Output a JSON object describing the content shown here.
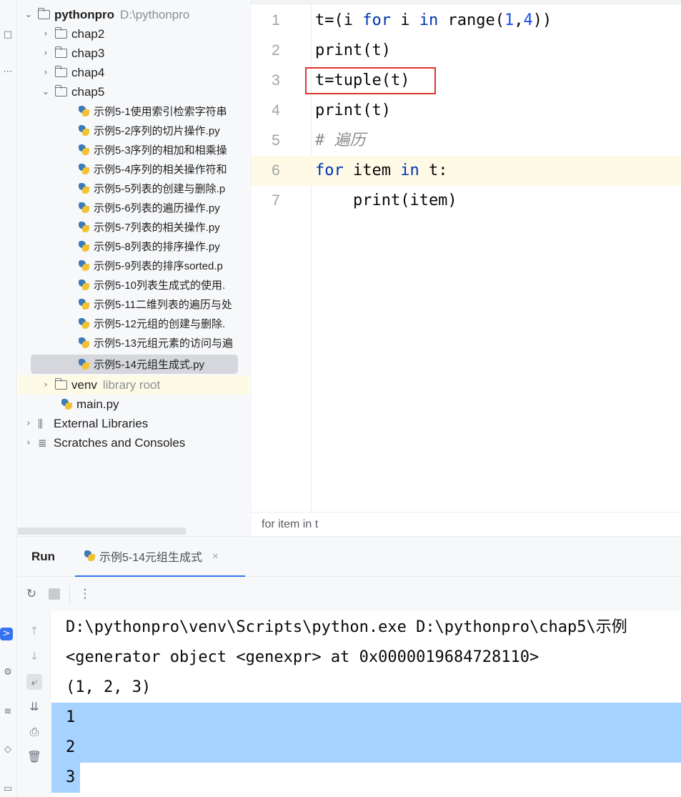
{
  "project_tree": {
    "root": {
      "name": "pythonpro",
      "path": "D:\\pythonpro"
    },
    "folders": [
      {
        "name": "chap2"
      },
      {
        "name": "chap3"
      },
      {
        "name": "chap4"
      },
      {
        "name": "chap5"
      }
    ],
    "chap5_files": [
      "示例5-1使用索引检索字符串",
      "示例5-2序列的切片操作.py",
      "示例5-3序列的相加和相乘操",
      "示例5-4序列的相关操作符和",
      "示例5-5列表的创建与删除.p",
      "示例5-6列表的遍历操作.py",
      "示例5-7列表的相关操作.py",
      "示例5-8列表的排序操作.py",
      "示例5-9列表的排序sorted.p",
      "示例5-10列表生成式的使用.",
      "示例5-11二维列表的遍历与处",
      "示例5-12元组的创建与删除.",
      "示例5-13元组元素的访问与遍",
      "示例5-14元组生成式.py"
    ],
    "venv": {
      "name": "venv",
      "hint": "library root"
    },
    "main_file": "main.py",
    "external_libraries": "External Libraries",
    "scratches": "Scratches and Consoles"
  },
  "editor": {
    "line_numbers": [
      "1",
      "2",
      "3",
      "4",
      "5",
      "6",
      "7"
    ],
    "breadcrumb": "for item in t"
  },
  "run": {
    "title": "Run",
    "tab_label": "示例5-14元组生成式",
    "tab_close": "×",
    "output": [
      "D:\\pythonpro\\venv\\Scripts\\python.exe D:\\pythonpro\\chap5\\示例",
      "<generator object <genexpr> at 0x0000019684728110>",
      "(1, 2, 3)",
      "1",
      "2",
      "3"
    ]
  },
  "colors": {
    "accent": "#3574f0",
    "highlight_box": "#e0342a",
    "selection": "#a6d2ff",
    "keyword": "#0033b3"
  }
}
